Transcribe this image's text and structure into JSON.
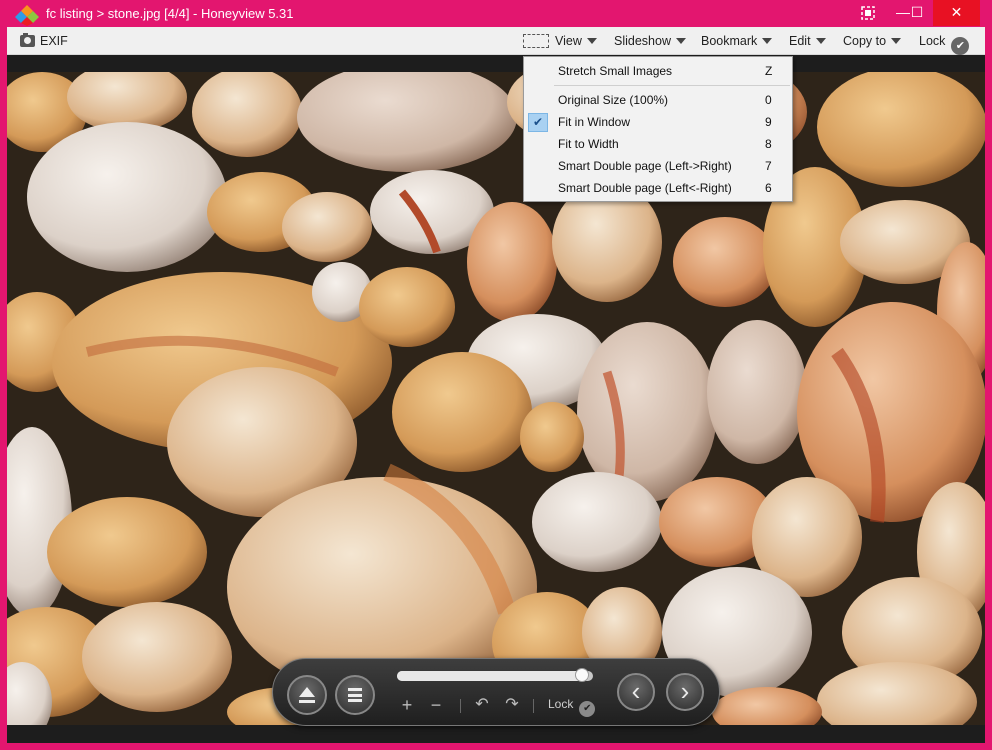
{
  "window": {
    "title": "fc listing > stone.jpg [4/4] - Honeyview 5.31",
    "accent_color": "#e3166f",
    "controls": {
      "capture_icon": "screen-capture-icon",
      "minimize": "—",
      "maximize": "☐",
      "close": "✕"
    }
  },
  "toolbar": {
    "exif_label": "EXIF",
    "view_label": "View",
    "slideshow_label": "Slideshow",
    "bookmark_label": "Bookmark",
    "edit_label": "Edit",
    "copy_to_label": "Copy to",
    "lock_label": "Lock",
    "lock_check": "✔"
  },
  "view_menu": {
    "items": [
      {
        "label": "Stretch Small Images",
        "key": "Z",
        "checked": false
      },
      {
        "label": "Original Size (100%)",
        "key": "0",
        "checked": false
      },
      {
        "label": "Fit in Window",
        "key": "9",
        "checked": true
      },
      {
        "label": "Fit to Width",
        "key": "8",
        "checked": false
      },
      {
        "label": "Smart Double page (Left->Right)",
        "key": "7",
        "checked": false
      },
      {
        "label": "Smart Double page (Left<-Right)",
        "key": "6",
        "checked": false
      }
    ],
    "check_glyph": "✔"
  },
  "controller": {
    "slider_value": 0.98,
    "zoom_in": "+",
    "zoom_out": "−",
    "rotate_left": "↶",
    "rotate_right": "↷",
    "lock_label": "Lock",
    "lock_check": "✔",
    "prev": "‹",
    "next": "›"
  },
  "image": {
    "subject": "stone.jpg"
  }
}
